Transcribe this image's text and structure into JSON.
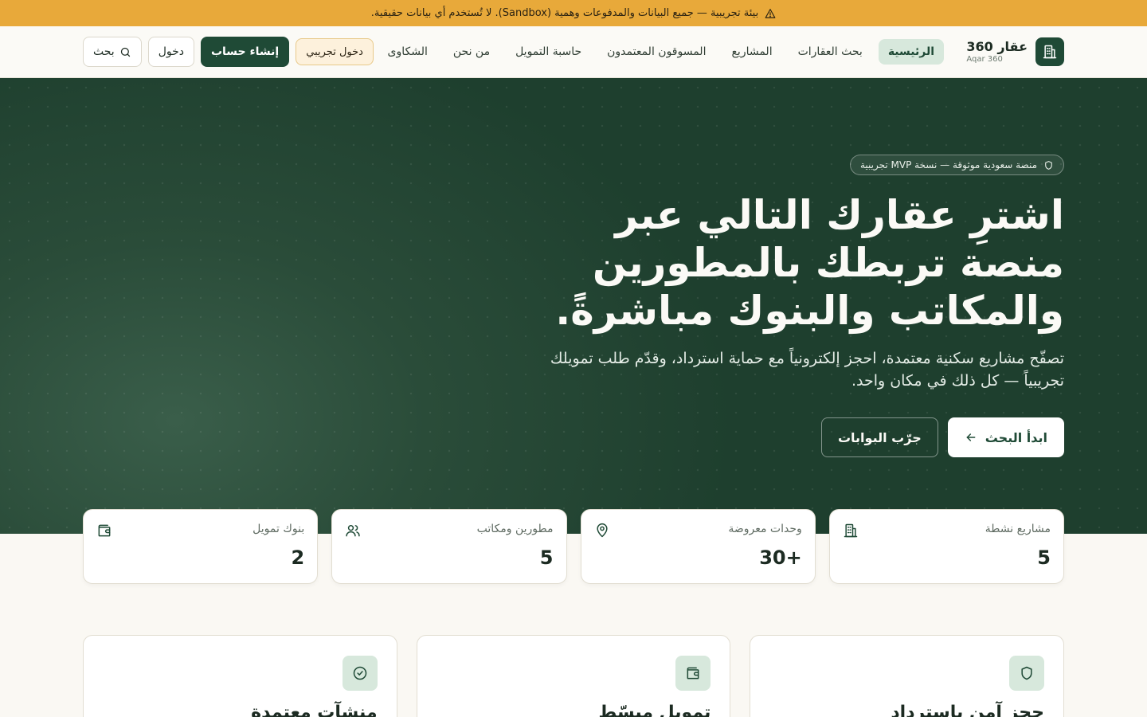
{
  "banner": {
    "text": "بيئة تجريبية — جميع البيانات والمدفوعات وهمية (Sandbox). لا تُستخدم أي بيانات حقيقية.",
    "icon": "warning-icon"
  },
  "brand": {
    "name": "عقار 360",
    "sub": "Aqar 360",
    "icon": "building-icon"
  },
  "nav": {
    "items": [
      {
        "label": "الرئيسية",
        "active": true
      },
      {
        "label": "بحث العقارات"
      },
      {
        "label": "المشاريع"
      },
      {
        "label": "المسوقون المعتمدون"
      },
      {
        "label": "حاسبة التمويل"
      },
      {
        "label": "من نحن"
      },
      {
        "label": "الشكاوى"
      }
    ],
    "search_label": "بحث",
    "login_label": "دخول",
    "signup_label": "إنشاء حساب",
    "demo_label": "دخول تجريبي"
  },
  "hero": {
    "badge": "منصة سعودية موثوقة — نسخة MVP تجريبية",
    "title": "اشترِ عقارك التالي عبر منصة تربطك بالمطورين والمكاتب والبنوك مباشرةً.",
    "subtitle": "تصفّح مشاريع سكنية معتمدة، احجز إلكترونياً مع حماية استرداد، وقدّم طلب تمويلك تجريبياً — كل ذلك في مكان واحد.",
    "primary_cta": "ابدأ البحث",
    "secondary_cta": "جرّب البوابات"
  },
  "stats": [
    {
      "label": "مشاريع نشطة",
      "value": "5",
      "icon": "building-icon"
    },
    {
      "label": "وحدات معروضة",
      "value": "+30",
      "icon": "map-pin-icon"
    },
    {
      "label": "مطورين ومكاتب",
      "value": "5",
      "icon": "users-icon"
    },
    {
      "label": "بنوك تمويل",
      "value": "2",
      "icon": "wallet-icon"
    }
  ],
  "features": [
    {
      "title": "حجز آمن باسترداد",
      "icon": "shield-icon"
    },
    {
      "title": "تمويل مبسّط",
      "icon": "wallet-icon"
    },
    {
      "title": "منشآت معتمدة",
      "icon": "check-circle-icon"
    }
  ],
  "colors": {
    "brand": "#1f4a36",
    "banner": "#e8a93a",
    "accent_light": "#d7e8dc"
  }
}
